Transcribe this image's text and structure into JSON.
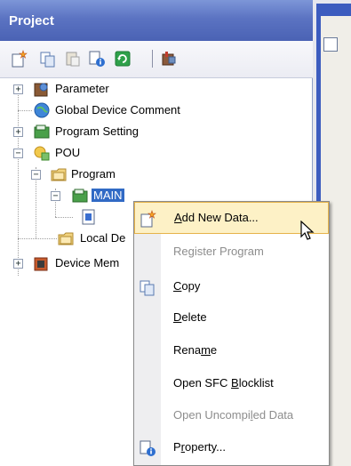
{
  "panel": {
    "title": "Project",
    "toolbar": [
      "new-data-icon",
      "copy-icon",
      "paste-icon",
      "property-icon",
      "refresh-icon",
      "device-icon"
    ]
  },
  "tree": {
    "parameter": "Parameter",
    "global_device_comment": "Global Device Comment",
    "program_setting": "Program Setting",
    "pou": "POU",
    "program": "Program",
    "main": "MAIN",
    "local_device": "Local De",
    "device_memory": "Device Mem"
  },
  "context_menu": {
    "items": [
      {
        "label": "Add New Data...",
        "underline": "A",
        "rest": "dd New Data...",
        "enabled": true,
        "icon": "new-data-icon"
      },
      {
        "label": "Register Program",
        "enabled": false
      },
      {
        "label": "Copy",
        "underline": "C",
        "rest": "opy",
        "enabled": true,
        "icon": "copy-icon"
      },
      {
        "label": "Delete",
        "underline": "D",
        "rest": "elete",
        "enabled": true
      },
      {
        "label": "Rename",
        "pre": "Rena",
        "underline": "m",
        "post": "e",
        "enabled": true
      },
      {
        "label": "Open SFC Blocklist",
        "pre": "Open SFC ",
        "underline": "B",
        "post": "locklist",
        "enabled": true
      },
      {
        "label": "Open Uncompiled Data",
        "pre": "Open Uncompi",
        "underline": "l",
        "post": "ed Data",
        "enabled": false
      },
      {
        "label": "Property...",
        "pre": "P",
        "underline": "r",
        "post": "operty...",
        "enabled": true,
        "icon": "property-icon"
      }
    ]
  },
  "colors": {
    "title_blue": "#5b73c2",
    "selection_blue": "#316ac5",
    "menu_hover": "#fdf1c6",
    "menu_hover_border": "#e6b34a"
  }
}
